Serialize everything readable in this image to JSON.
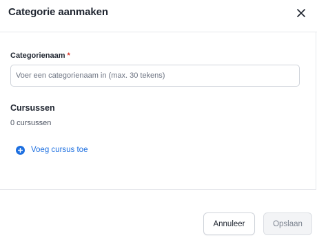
{
  "dialog": {
    "title": "Categorie aanmaken"
  },
  "form": {
    "name_label": "Categorienaam",
    "required_marker": "*",
    "name_value": "",
    "name_placeholder": "Voer een categorienaam in (max. 30 tekens)"
  },
  "courses": {
    "section_title": "Cursussen",
    "count_text": "0 cursussen",
    "add_label": "Voeg cursus toe"
  },
  "footer": {
    "cancel_label": "Annuleer",
    "save_label": "Opslaan"
  },
  "icons": {
    "close": "close-icon",
    "add": "plus-circle-icon"
  },
  "colors": {
    "accent": "#1d6fe0",
    "required": "#d92d20",
    "disabled_bg": "#f3f4f6",
    "disabled_text": "#7c838f"
  }
}
